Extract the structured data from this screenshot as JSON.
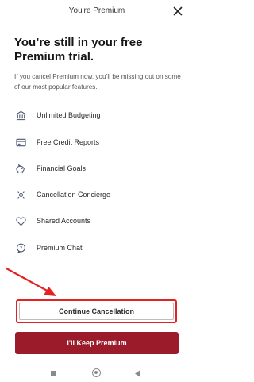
{
  "header": {
    "title": "You're Premium",
    "close_icon": "close-icon"
  },
  "headline": "You’re still in your free Premium trial.",
  "subtext": "If you cancel Premium now, you’ll be missing out on some of our most popular features.",
  "features": [
    {
      "label": "Unlimited Budgeting",
      "icon": "bank-icon"
    },
    {
      "label": "Free Credit Reports",
      "icon": "credit-card-icon"
    },
    {
      "label": "Financial Goals",
      "icon": "piggy-bank-icon"
    },
    {
      "label": "Cancellation Concierge",
      "icon": "gear-icon"
    },
    {
      "label": "Shared Accounts",
      "icon": "heart-icon"
    },
    {
      "label": "Premium Chat",
      "icon": "chat-icon"
    }
  ],
  "buttons": {
    "continue_label": "Continue Cancellation",
    "keep_label": "I'll Keep Premium"
  },
  "colors": {
    "brand": "#9b1b2b",
    "annotation": "#e52222"
  }
}
